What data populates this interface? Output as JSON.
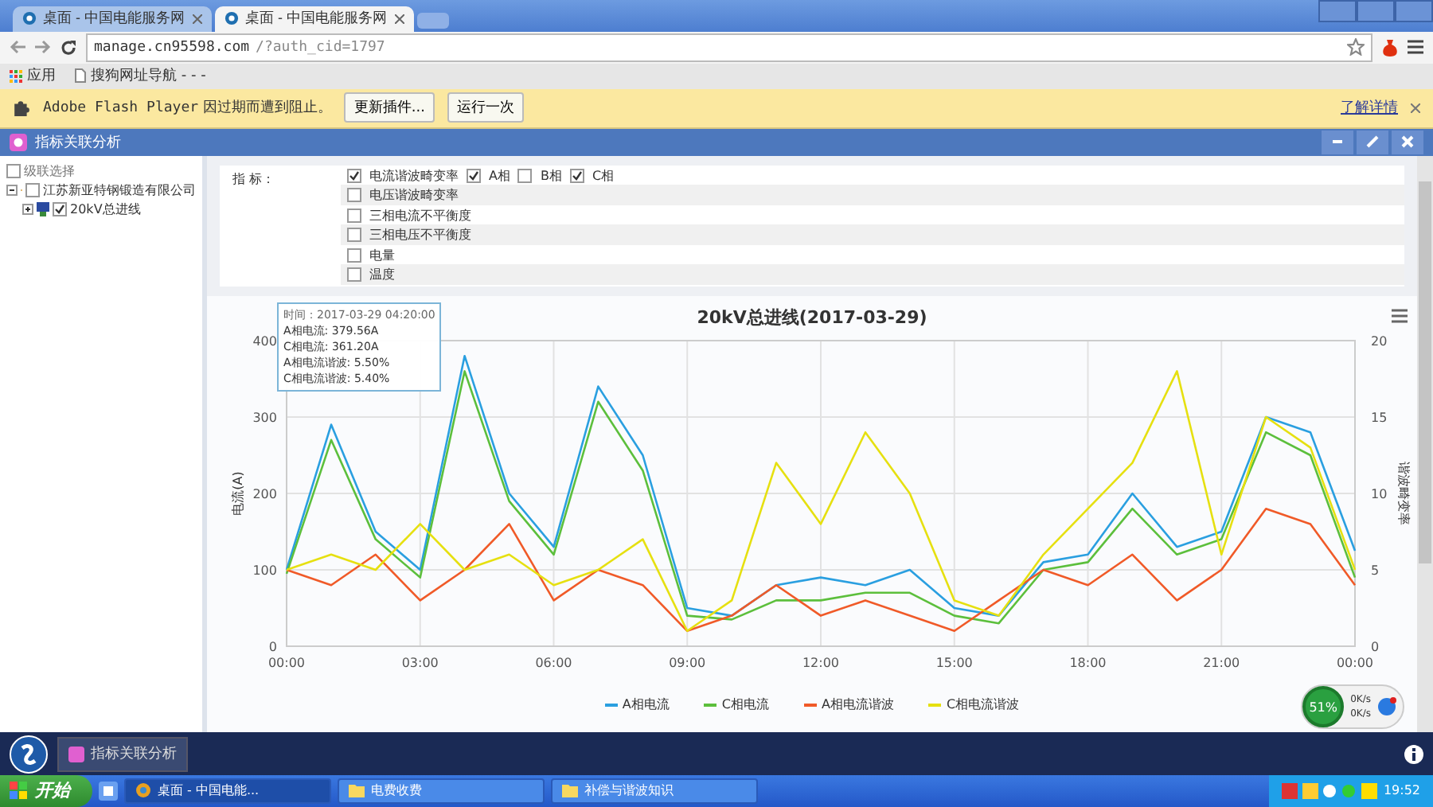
{
  "browser": {
    "tabs": [
      {
        "title": "桌面 - 中国电能服务网",
        "selected": false
      },
      {
        "title": "桌面 - 中国电能服务网",
        "selected": true
      }
    ],
    "url": {
      "host": "manage.cn95598.com",
      "path": "/?auth_cid=1797"
    },
    "bookmarks": [
      "应用",
      "搜狗网址导航 - - -"
    ],
    "flash_bar": {
      "plugin": "Adobe Flash Player",
      "message": "因过期而遭到阻止。",
      "buttons": [
        "更新插件...",
        "运行一次"
      ],
      "link": "了解详情"
    }
  },
  "app": {
    "title": "指标关联分析",
    "tree": {
      "header": {
        "label": "级联选择",
        "checked": false
      },
      "items": [
        {
          "label": "江苏新亚特钢锻造有限公司",
          "checked": false,
          "expanded": true,
          "children": [
            {
              "label": "20kV总进线",
              "checked": true,
              "expanded": false
            }
          ]
        }
      ]
    },
    "indicators": {
      "label": "指 标：",
      "rows": [
        {
          "label": "电流谐波畸变率",
          "checked": true,
          "phases": [
            {
              "label": "A相",
              "checked": true
            },
            {
              "label": "B相",
              "checked": false
            },
            {
              "label": "C相",
              "checked": true
            }
          ]
        },
        {
          "label": "电压谐波畸变率",
          "checked": false
        },
        {
          "label": "三相电流不平衡度",
          "checked": false
        },
        {
          "label": "三相电压不平衡度",
          "checked": false
        },
        {
          "label": "电量",
          "checked": false
        },
        {
          "label": "温度",
          "checked": false
        }
      ]
    },
    "tooltip": [
      "时间：2017-03-29 04:20:00",
      "A相电流: 379.56A",
      "C相电流: 361.20A",
      "A相电流谐波: 5.50%",
      "C相电流谐波: 5.40%"
    ],
    "chart_data": {
      "type": "line",
      "title": "20kV总进线(2017-03-29)",
      "ylabel": "电流(A)",
      "y2label": "谐波畸变率",
      "x": [
        0,
        1,
        2,
        3,
        4,
        5,
        6,
        7,
        8,
        9,
        10,
        11,
        12,
        13,
        14,
        15,
        16,
        17,
        18,
        19,
        20,
        21,
        22,
        23,
        24
      ],
      "grid": true,
      "xlim": [
        0,
        24
      ],
      "ylim": [
        0,
        400
      ],
      "y2lim": [
        0,
        20
      ],
      "xticks": [
        {
          "value": 0,
          "label": "00:00"
        },
        {
          "value": 3,
          "label": "03:00"
        },
        {
          "value": 6,
          "label": "06:00"
        },
        {
          "value": 9,
          "label": "09:00"
        },
        {
          "value": 12,
          "label": "12:00"
        },
        {
          "value": 15,
          "label": "15:00"
        },
        {
          "value": 18,
          "label": "18:00"
        },
        {
          "value": 21,
          "label": "21:00"
        },
        {
          "value": 24,
          "label": "00:00"
        }
      ],
      "yticks": [
        0,
        100,
        200,
        300,
        400
      ],
      "y2ticks": [
        0,
        5,
        10,
        15,
        20
      ],
      "series": [
        {
          "name": "A相电流",
          "color": "#2a9fe0",
          "values": [
            100,
            290,
            150,
            100,
            380,
            200,
            130,
            340,
            250,
            50,
            40,
            80,
            90,
            80,
            100,
            50,
            40,
            110,
            120,
            200,
            130,
            150,
            300,
            280,
            125
          ]
        },
        {
          "name": "C相电流",
          "color": "#5cbf3c",
          "values": [
            95,
            270,
            140,
            90,
            360,
            190,
            120,
            320,
            230,
            40,
            35,
            60,
            60,
            70,
            70,
            40,
            30,
            100,
            110,
            180,
            120,
            140,
            280,
            250,
            90
          ]
        },
        {
          "name": "A相电流谐波",
          "color": "#f05a28",
          "axis": "y2",
          "values": [
            5,
            4,
            6,
            3,
            5,
            8,
            3,
            5,
            4,
            1,
            2,
            4,
            2,
            3,
            2,
            1,
            3,
            5,
            4,
            6,
            3,
            5,
            9,
            8,
            4
          ]
        },
        {
          "name": "C相电流谐波",
          "color": "#e6e010",
          "axis": "y2",
          "values": [
            5,
            6,
            5,
            8,
            5,
            6,
            4,
            5,
            7,
            1,
            3,
            12,
            8,
            14,
            10,
            3,
            2,
            6,
            9,
            12,
            18,
            6,
            15,
            13,
            5
          ]
        }
      ]
    }
  },
  "network": {
    "cpu": "51%",
    "up": "0K/s",
    "down": "0K/s"
  },
  "app_tab": "指标关联分析",
  "taskbar": {
    "start": "开始",
    "items": [
      {
        "label": "桌面 - 中国电能...",
        "selected": true
      },
      {
        "label": "电费收费",
        "selected": false
      },
      {
        "label": "补偿与谐波知识",
        "selected": false
      }
    ],
    "clock": "19:52"
  }
}
